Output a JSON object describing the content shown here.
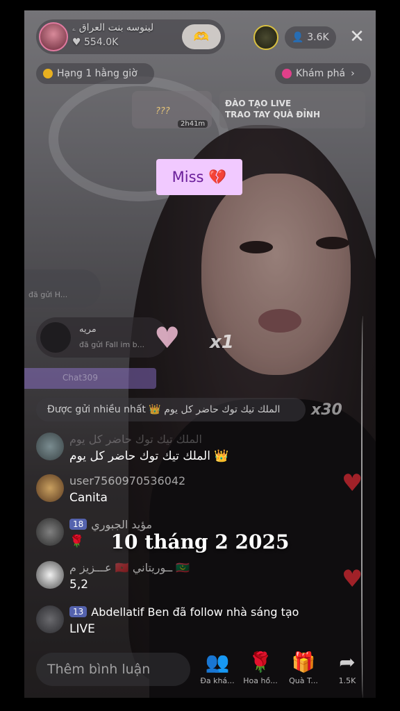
{
  "host": {
    "name": "لينوسه بنت العراق ۦ",
    "likes": "554.0K"
  },
  "viewers": {
    "count": "3.6K"
  },
  "top_bar": {
    "rank_label": "Hạng 1 hằng giờ",
    "explore_label": "Khám phá"
  },
  "cards": {
    "card1_text": "???",
    "card1_time": "2h41m",
    "card2_line1": "ĐÀO TẠO LIVE",
    "card2_line2": "TRAO TAY QUÀ ĐỈNH"
  },
  "overlay_sticker": {
    "text": "Miss 💔"
  },
  "gifts": {
    "row1_text": "đã gửi H...",
    "row2_name": "مريه",
    "row2_sub": "đã gửi Fall im b...",
    "multiplier_1": "x1",
    "purple_text": "Chat309",
    "multiplier_2": "x30"
  },
  "most_sent": {
    "label": "Được gửi nhiều nhất 👑 الملك تيك توك حاضر كل يوم"
  },
  "comments": [
    {
      "user": "الملك تيك توك حاضر كل يوم",
      "badge": "",
      "message": "الملك تيك توك حاضر كل يوم 👑"
    },
    {
      "user": "user7560970536042",
      "badge": "",
      "message": "Canita"
    },
    {
      "user": "مؤيد الجبوري",
      "badge": "18",
      "message": "🌹"
    },
    {
      "user": "عـــزيز م 🇲🇦 ــوريتاني 🇲🇷",
      "badge": "",
      "message": "5,2"
    },
    {
      "user": "Abdellatif Ben đã follow nhà sáng tạo",
      "badge": "13",
      "message": "LIVE"
    }
  ],
  "date_caption": "10 tháng 2 2025",
  "bottom": {
    "input_placeholder": "Thêm bình luận",
    "actions": [
      {
        "icon": "people-icon",
        "label": "Đa khá..."
      },
      {
        "icon": "rose-icon",
        "label": "Hoa hồ..."
      },
      {
        "icon": "gift-icon",
        "label": "Quà T..."
      },
      {
        "icon": "share-icon",
        "label": "1.5K"
      }
    ]
  }
}
